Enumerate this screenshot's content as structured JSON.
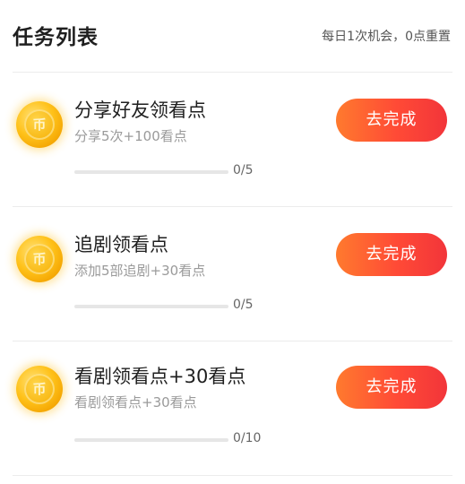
{
  "header": {
    "title": "任务列表",
    "note": "每日1次机会，0点重置"
  },
  "tasks": [
    {
      "title": "分享好友领看点",
      "description": "分享5次+100看点",
      "progress_text": "0/5",
      "progress_done": 0,
      "progress_total": 5,
      "button_label": "去完成",
      "icon": "coin-icon",
      "coin_glyph": "币"
    },
    {
      "title": "追剧领看点",
      "description": "添加5部追剧+30看点",
      "progress_text": "0/5",
      "progress_done": 0,
      "progress_total": 5,
      "button_label": "去完成",
      "icon": "coin-icon",
      "coin_glyph": "币"
    },
    {
      "title": "看剧领看点+30看点",
      "description": "看剧领看点+30看点",
      "progress_text": "0/10",
      "progress_done": 0,
      "progress_total": 10,
      "button_label": "去完成",
      "icon": "coin-icon",
      "coin_glyph": "币"
    }
  ],
  "colors": {
    "button_gradient_start": "#ff7a2e",
    "button_gradient_end": "#f2353a",
    "coin_gold": "#ffc21a"
  }
}
